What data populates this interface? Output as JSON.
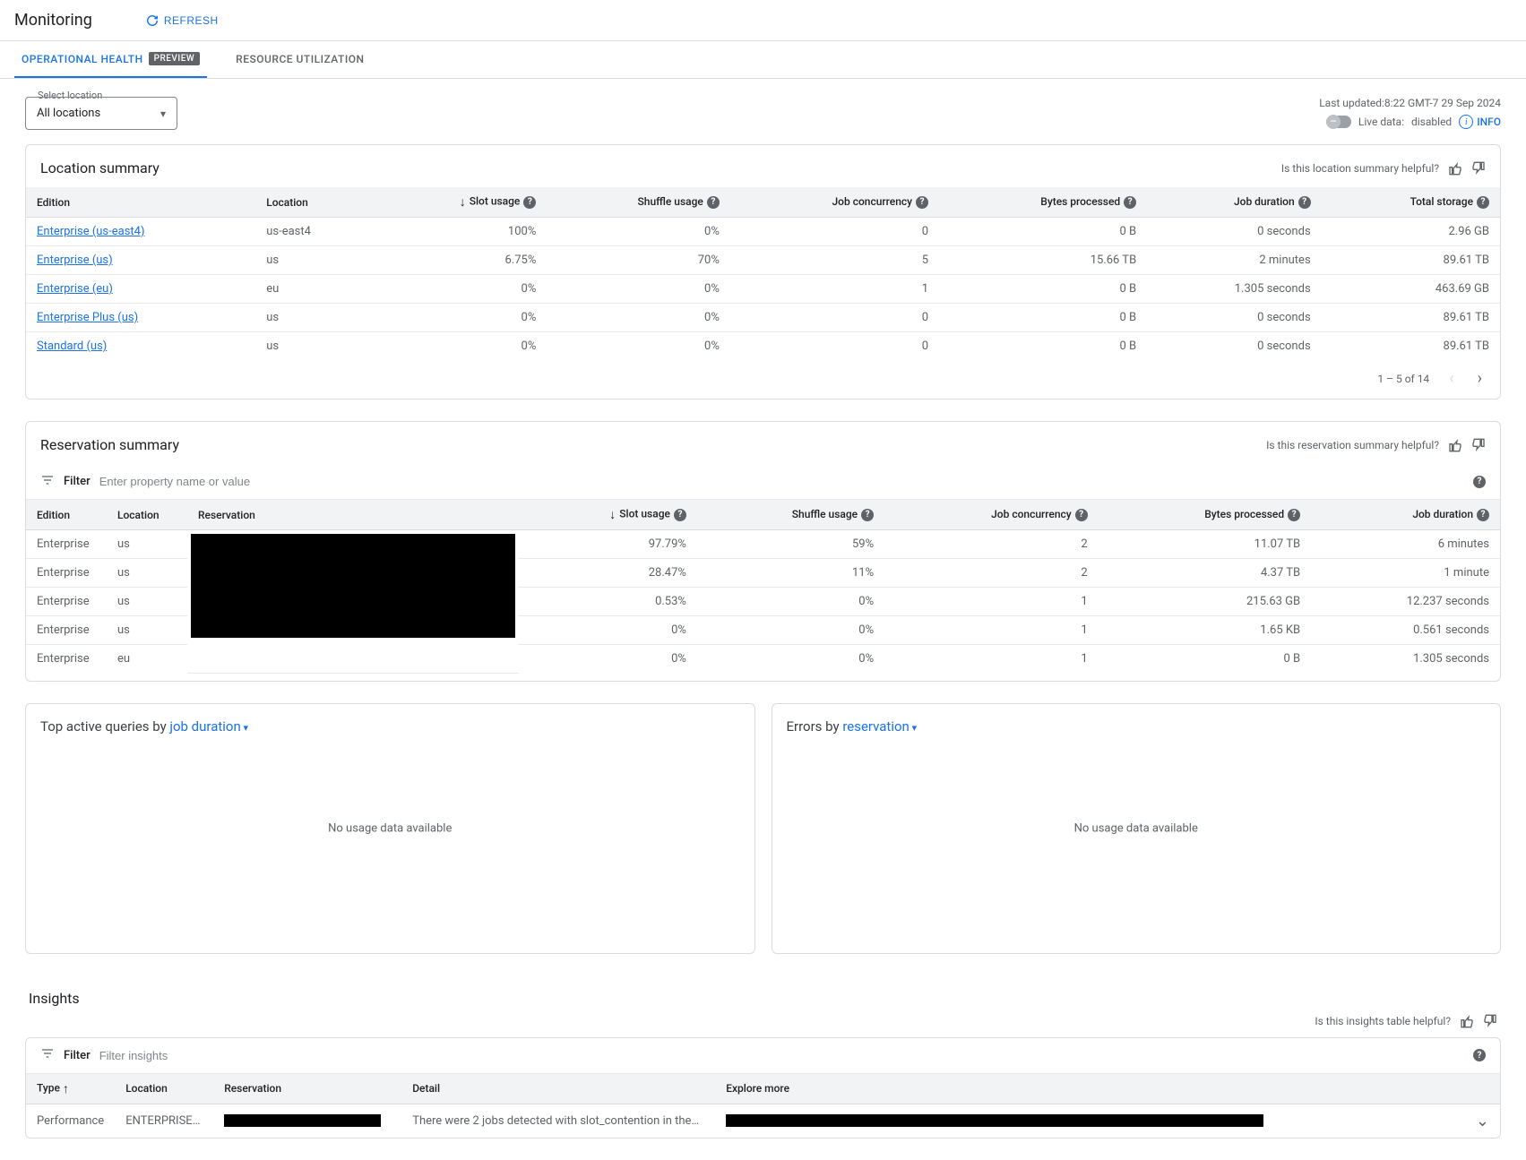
{
  "header": {
    "title": "Monitoring",
    "refresh": "REFRESH"
  },
  "tabs": {
    "op_health": "OPERATIONAL HEALTH",
    "preview": "PREVIEW",
    "resource": "RESOURCE UTILIZATION"
  },
  "toolbar": {
    "select_label": "Select location",
    "select_value": "All locations",
    "last_updated": "Last updated:8:22 GMT-7 29 Sep 2024",
    "live_label": "Live data:",
    "live_status": "disabled",
    "info": "INFO"
  },
  "location_summary": {
    "title": "Location summary",
    "helpful": "Is this location summary helpful?",
    "headers": {
      "edition": "Edition",
      "location": "Location",
      "slot": "Slot usage",
      "shuffle": "Shuffle usage",
      "concurrency": "Job concurrency",
      "bytes": "Bytes processed",
      "duration": "Job duration",
      "storage": "Total storage"
    },
    "rows": [
      {
        "edition": "Enterprise (us-east4)",
        "location": "us-east4",
        "slot": "100%",
        "shuffle": "0%",
        "concurrency": "0",
        "bytes": "0 B",
        "duration": "0 seconds",
        "storage": "2.96 GB"
      },
      {
        "edition": "Enterprise (us)",
        "location": "us",
        "slot": "6.75%",
        "shuffle": "70%",
        "concurrency": "5",
        "bytes": "15.66 TB",
        "duration": "2 minutes",
        "storage": "89.61 TB"
      },
      {
        "edition": "Enterprise (eu)",
        "location": "eu",
        "slot": "0%",
        "shuffle": "0%",
        "concurrency": "1",
        "bytes": "0 B",
        "duration": "1.305 seconds",
        "storage": "463.69 GB"
      },
      {
        "edition": "Enterprise Plus (us)",
        "location": "us",
        "slot": "0%",
        "shuffle": "0%",
        "concurrency": "0",
        "bytes": "0 B",
        "duration": "0 seconds",
        "storage": "89.61 TB"
      },
      {
        "edition": "Standard (us)",
        "location": "us",
        "slot": "0%",
        "shuffle": "0%",
        "concurrency": "0",
        "bytes": "0 B",
        "duration": "0 seconds",
        "storage": "89.61 TB"
      }
    ],
    "pagination": "1 – 5 of 14"
  },
  "reservation_summary": {
    "title": "Reservation summary",
    "helpful": "Is this reservation summary helpful?",
    "filter_label": "Filter",
    "filter_placeholder": "Enter property name or value",
    "headers": {
      "edition": "Edition",
      "location": "Location",
      "reservation": "Reservation",
      "slot": "Slot usage",
      "shuffle": "Shuffle usage",
      "concurrency": "Job concurrency",
      "bytes": "Bytes processed",
      "duration": "Job duration"
    },
    "rows": [
      {
        "edition": "Enterprise",
        "location": "us",
        "slot": "97.79%",
        "shuffle": "59%",
        "concurrency": "2",
        "bytes": "11.07 TB",
        "duration": "6 minutes"
      },
      {
        "edition": "Enterprise",
        "location": "us",
        "slot": "28.47%",
        "shuffle": "11%",
        "concurrency": "2",
        "bytes": "4.37 TB",
        "duration": "1 minute"
      },
      {
        "edition": "Enterprise",
        "location": "us",
        "slot": "0.53%",
        "shuffle": "0%",
        "concurrency": "1",
        "bytes": "215.63 GB",
        "duration": "12.237 seconds"
      },
      {
        "edition": "Enterprise",
        "location": "us",
        "slot": "0%",
        "shuffle": "0%",
        "concurrency": "1",
        "bytes": "1.65 KB",
        "duration": "0.561 seconds"
      },
      {
        "edition": "Enterprise",
        "location": "eu",
        "slot": "0%",
        "shuffle": "0%",
        "concurrency": "1",
        "bytes": "0 B",
        "duration": "1.305 seconds"
      }
    ]
  },
  "panels": {
    "queries_prefix": "Top active queries by ",
    "queries_dropdown": "job duration",
    "errors_prefix": "Errors by ",
    "errors_dropdown": "reservation",
    "no_data": "No usage data available"
  },
  "insights": {
    "title": "Insights",
    "helpful": "Is this insights table helpful?",
    "filter_label": "Filter",
    "filter_placeholder": "Filter insights",
    "headers": {
      "type": "Type",
      "location": "Location",
      "reservation": "Reservation",
      "detail": "Detail",
      "explore": "Explore more"
    },
    "row": {
      "type": "Performance",
      "location": "ENTERPRISE…",
      "detail": "There were 2 jobs detected with slot_contention in the…"
    }
  }
}
